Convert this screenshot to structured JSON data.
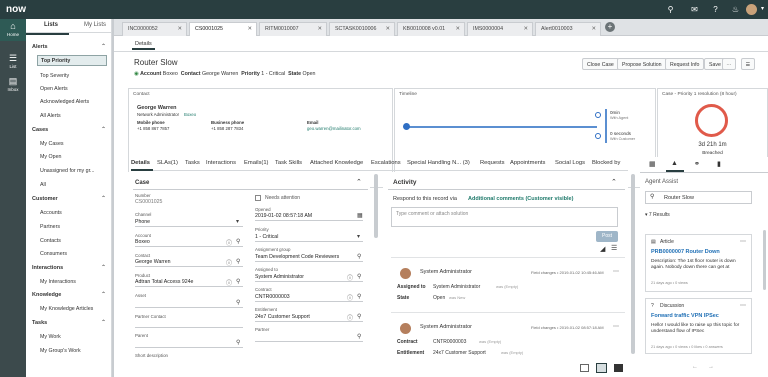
{
  "topbar": {
    "logo": "now",
    "icons": [
      "search-icon",
      "chat-icon",
      "help-icon",
      "bell-icon",
      "avatar",
      "gear-icon"
    ]
  },
  "rail": {
    "items": [
      {
        "label": "Home"
      },
      {
        "label": "List"
      },
      {
        "label": "Inbox"
      }
    ]
  },
  "lists": {
    "tabs": [
      "Lists",
      "My Lists"
    ],
    "sections": [
      {
        "title": "Alerts",
        "items": [
          "Top Priority",
          "Top Severity",
          "Open Alerts",
          "Acknowledged Alerts",
          "All Alerts"
        ]
      },
      {
        "title": "Cases",
        "items": [
          "My Cases",
          "My Open",
          "Unassigned for my gr...",
          "All"
        ]
      },
      {
        "title": "Customer",
        "items": [
          "Accounts",
          "Partners",
          "Contacts",
          "Consumers"
        ]
      },
      {
        "title": "Interactions",
        "items": [
          "My Interactions"
        ]
      },
      {
        "title": "Knowledge",
        "items": [
          "My Knowledge Articles"
        ]
      },
      {
        "title": "Tasks",
        "items": [
          "My Work",
          "My Group's Work"
        ]
      }
    ],
    "selected": "Top Priority"
  },
  "record_tabs": [
    {
      "label": "INC0000052"
    },
    {
      "label": "CS0001025",
      "active": true
    },
    {
      "label": "RITM0010007"
    },
    {
      "label": "SCTASK0010006"
    },
    {
      "label": "KB0010008 v0.01"
    },
    {
      "label": "IMS0000004"
    },
    {
      "label": "Alert0010003"
    }
  ],
  "details_tab": "Details",
  "record": {
    "title": "Router Slow",
    "account_label": "Account",
    "account": "Boxeo",
    "contact_label": "Contact",
    "contact": "George Warren",
    "priority_label": "Priority",
    "priority": "1 - Critical",
    "state_label": "State",
    "state": "Open"
  },
  "actions": [
    "Close Case",
    "Propose Solution",
    "Request Info",
    "Save"
  ],
  "contact_card": {
    "header": "Contact",
    "name": "George Warren",
    "role": "Network Administrator",
    "company": "Boxeo",
    "mobile_label": "Mobile phone",
    "mobile": "+1 858 867 7857",
    "business_label": "Business phone",
    "business": "+1 858 287 7834",
    "email_label": "Email",
    "email": "geo.warren@mailinator.com"
  },
  "timeline_card": {
    "header": "Timeline",
    "event1_value": "0min",
    "event1_sub": "With Agent",
    "event2_value": "0 seconds",
    "event2_sub": "With Customer"
  },
  "sla_card": {
    "header": "Case - Priority 1 resolution (8 hour)",
    "time": "3d 21h 1m",
    "status": "Breached",
    "breach_fraction": 1.0
  },
  "form_tabs": [
    "Details",
    "SLAs(1)",
    "Tasks",
    "Interactions",
    "Emails(1)",
    "Task Skills",
    "Attached Knowledge",
    "Escalations",
    "Special Handling N... (3)",
    "Requests",
    "Appointments",
    "Social Logs",
    "Blocked by"
  ],
  "form": {
    "section": "Case",
    "left": [
      {
        "label": "Number",
        "value": "CS0001025"
      },
      {
        "label": "Channel",
        "value": "Phone"
      },
      {
        "label": "Account",
        "value": "Boxeo"
      },
      {
        "label": "Contact",
        "value": "George Warren"
      },
      {
        "label": "Product",
        "value": "Adtran Total Access 924e"
      },
      {
        "label": "Asset",
        "value": ""
      },
      {
        "label": "Partner Contact",
        "value": ""
      },
      {
        "label": "Parent",
        "value": ""
      },
      {
        "label": "Short description",
        "value": ""
      }
    ],
    "right": [
      {
        "label": "Needs attention",
        "value": ""
      },
      {
        "label": "Opened",
        "value": "2019-01-02 08:57:18 AM"
      },
      {
        "label": "Priority",
        "value": "1 - Critical"
      },
      {
        "label": "Assignment group",
        "value": "Team Development Code Reviewers"
      },
      {
        "label": "Assigned to",
        "value": "System Administrator"
      },
      {
        "label": "Contract",
        "value": "CNTR0000003"
      },
      {
        "label": "Entitlement",
        "value": "24x7 Customer Support"
      },
      {
        "label": "Partner",
        "value": ""
      }
    ]
  },
  "activity": {
    "title": "Activity",
    "respond_label": "Respond to this record via",
    "respond_mode": "Additional comments (Customer visible)",
    "placeholder": "Type comment or attach solution",
    "post": "Post",
    "entries": [
      {
        "user": "System Administrator",
        "meta": "Field changes • 2019-01-02 10:45:46 AM",
        "fields": [
          {
            "k": "Assigned to",
            "v": "System Administrator",
            "old": "was (Empty)"
          },
          {
            "k": "State",
            "v": "Open",
            "old": "was New"
          }
        ]
      },
      {
        "user": "System Administrator",
        "meta": "Field changes • 2019-01-02 08:57:18 AM",
        "fields": [
          {
            "k": "Contract",
            "v": "CNTR0000003",
            "old": "was (Empty)"
          },
          {
            "k": "Entitlement",
            "v": "24x7 Customer Support",
            "old": "was (Empty)"
          }
        ]
      }
    ]
  },
  "agent_assist": {
    "title": "Agent Assist",
    "query": "Router Slow",
    "results": "7 Results",
    "cards": [
      {
        "type": "Article",
        "title": "PRB0000007 Router Down",
        "body": "Description: The 1st floor router is down again. Nobody down there can get at",
        "meta": "21 days ago • 0 views"
      },
      {
        "type": "Discussion",
        "title": "Forward traffic VPN IPSec",
        "body": "Hello! I would like to raise up this topic for understand flow of IPSec",
        "meta": "21 days ago • 0 views • 0 likes • 0 answers"
      }
    ]
  }
}
